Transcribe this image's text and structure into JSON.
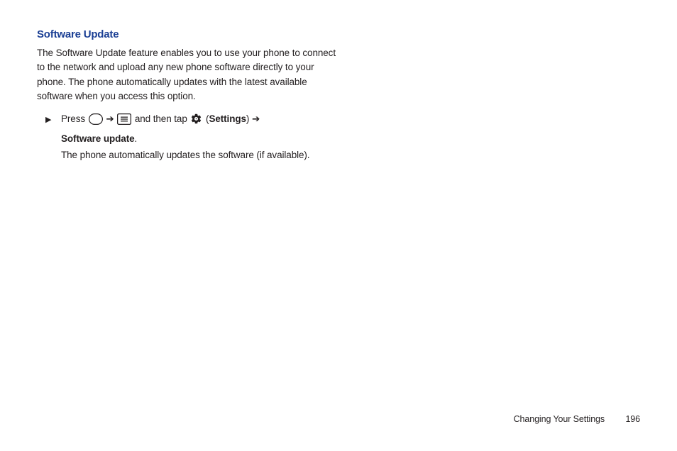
{
  "heading": {
    "text": "Software Update",
    "color": "#1b3f94"
  },
  "intro": "The Software Update feature enables you to use your phone to connect to the network and upload any new phone software directly to your phone. The phone automatically updates with the latest available software when you access this option.",
  "step": {
    "bullet": "▶",
    "t1": "Press ",
    "arrow1": " ➔ ",
    "t2": " and then tap ",
    "paren_open": " (",
    "settings_label": "Settings",
    "paren_close": ") ",
    "arrow2": "➔ ",
    "bold_tail": "Software update",
    "period": ".",
    "after": "The phone automatically updates the software (if available)."
  },
  "footer": {
    "section": "Changing Your Settings",
    "page": "196"
  }
}
